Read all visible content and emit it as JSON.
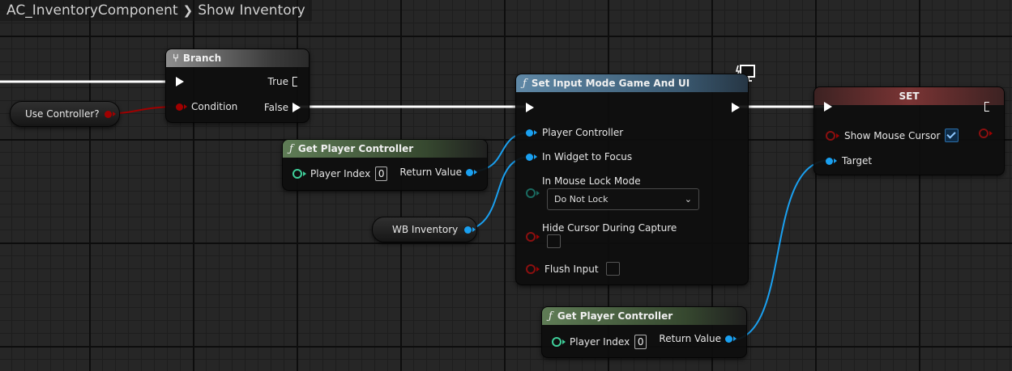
{
  "breadcrumb": {
    "component": "AC_InventoryComponent",
    "graph": "Show Inventory"
  },
  "variables": {
    "use_controller": "Use Controller?",
    "wb_inventory": "WB Inventory"
  },
  "branch": {
    "title": "Branch",
    "true_label": "True",
    "condition_label": "Condition",
    "false_label": "False"
  },
  "get_player_controller_1": {
    "title": "Get Player Controller",
    "player_index_label": "Player Index",
    "player_index_value": "0",
    "return_value_label": "Return Value"
  },
  "get_player_controller_2": {
    "title": "Get Player Controller",
    "player_index_label": "Player Index",
    "player_index_value": "0",
    "return_value_label": "Return Value"
  },
  "set_input_mode": {
    "title": "Set Input Mode Game And UI",
    "player_controller_label": "Player Controller",
    "widget_to_focus_label": "In Widget to Focus",
    "mouse_lock_mode_label": "In Mouse Lock Mode",
    "mouse_lock_mode_value": "Do Not Lock",
    "hide_cursor_label": "Hide Cursor During Capture",
    "flush_input_label": "Flush Input"
  },
  "set_node": {
    "title": "SET",
    "show_mouse_cursor_label": "Show Mouse Cursor",
    "show_mouse_cursor_checked": true,
    "target_label": "Target"
  },
  "colors": {
    "exec_wire": "#ffffff",
    "object_wire": "#1aa0f0",
    "bool_wire": "#a00000"
  },
  "icons": {
    "function": "function-icon",
    "branch": "branch-icon",
    "client_only": "client-only-icon"
  }
}
